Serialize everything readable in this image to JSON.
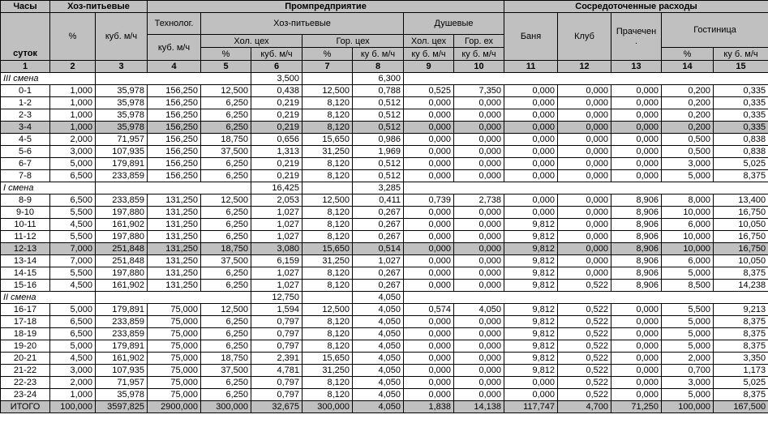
{
  "header": {
    "hours_top": "Часы",
    "hours_bottom": "суток",
    "household": "Хоз-питьевые",
    "pct": "%",
    "m3h": "куб. м/ч",
    "industry": "Промпредприятие",
    "concentrated": "Сосредоточенные расходы",
    "technolog": "Технолог.",
    "technolog_unit": "куб. м/ч",
    "industry_household": "Хоз-питьевые",
    "cold_shop": "Хол. цех",
    "hot_shop": "Гор. цех",
    "showers": "Душевые",
    "showers_cold": "Хол. цех",
    "showers_hot": "Гор. ех",
    "sub_pct": "%",
    "sub_m3h": "куб. м/ч",
    "sub_m3h_spaced": "ку б. м/ч",
    "banya": "Баня",
    "club": "Клуб",
    "laundry": "Прачечен",
    "laundry_dot": ".",
    "hotel": "Гостиница"
  },
  "column_numbers": [
    "1",
    "2",
    "3",
    "4",
    "5",
    "6",
    "7",
    "8",
    "9",
    "10",
    "11",
    "12",
    "13",
    "14",
    "15"
  ],
  "groups": [
    {
      "shift_label": "III смена",
      "shift_cold": "3,500",
      "shift_hot": "6,300",
      "rows": [
        {
          "band": false,
          "cells": [
            "0-1",
            "1,000",
            "35,978",
            "156,250",
            "12,500",
            "0,438",
            "12,500",
            "0,788",
            "0,525",
            "7,350",
            "0,000",
            "0,000",
            "0,000",
            "0,200",
            "0,335"
          ]
        },
        {
          "band": false,
          "cells": [
            "1-2",
            "1,000",
            "35,978",
            "156,250",
            "6,250",
            "0,219",
            "8,120",
            "0,512",
            "0,000",
            "0,000",
            "0,000",
            "0,000",
            "0,000",
            "0,200",
            "0,335"
          ]
        },
        {
          "band": false,
          "cells": [
            "2-3",
            "1,000",
            "35,978",
            "156,250",
            "6,250",
            "0,219",
            "8,120",
            "0,512",
            "0,000",
            "0,000",
            "0,000",
            "0,000",
            "0,000",
            "0,200",
            "0,335"
          ]
        },
        {
          "band": true,
          "cells": [
            "3-4",
            "1,000",
            "35,978",
            "156,250",
            "6,250",
            "0,219",
            "8,120",
            "0,512",
            "0,000",
            "0,000",
            "0,000",
            "0,000",
            "0,000",
            "0,200",
            "0,335"
          ]
        },
        {
          "band": false,
          "cells": [
            "4-5",
            "2,000",
            "71,957",
            "156,250",
            "18,750",
            "0,656",
            "15,650",
            "0,986",
            "0,000",
            "0,000",
            "0,000",
            "0,000",
            "0,000",
            "0,500",
            "0,838"
          ]
        },
        {
          "band": false,
          "cells": [
            "5-6",
            "3,000",
            "107,935",
            "156,250",
            "37,500",
            "1,313",
            "31,250",
            "1,969",
            "0,000",
            "0,000",
            "0,000",
            "0,000",
            "0,000",
            "0,500",
            "0,838"
          ]
        },
        {
          "band": false,
          "cells": [
            "6-7",
            "5,000",
            "179,891",
            "156,250",
            "6,250",
            "0,219",
            "8,120",
            "0,512",
            "0,000",
            "0,000",
            "0,000",
            "0,000",
            "0,000",
            "3,000",
            "5,025"
          ]
        },
        {
          "band": false,
          "cells": [
            "7-8",
            "6,500",
            "233,859",
            "156,250",
            "6,250",
            "0,219",
            "8,120",
            "0,512",
            "0,000",
            "0,000",
            "0,000",
            "0,000",
            "0,000",
            "5,000",
            "8,375"
          ]
        }
      ]
    },
    {
      "shift_label": "I смена",
      "shift_cold": "16,425",
      "shift_hot": "3,285",
      "rows": [
        {
          "band": false,
          "cells": [
            "8-9",
            "6,500",
            "233,859",
            "131,250",
            "12,500",
            "2,053",
            "12,500",
            "0,411",
            "0,739",
            "2,738",
            "0,000",
            "0,000",
            "8,906",
            "8,000",
            "13,400"
          ]
        },
        {
          "band": false,
          "cells": [
            "9-10",
            "5,500",
            "197,880",
            "131,250",
            "6,250",
            "1,027",
            "8,120",
            "0,267",
            "0,000",
            "0,000",
            "0,000",
            "0,000",
            "8,906",
            "10,000",
            "16,750"
          ]
        },
        {
          "band": false,
          "cells": [
            "10-11",
            "4,500",
            "161,902",
            "131,250",
            "6,250",
            "1,027",
            "8,120",
            "0,267",
            "0,000",
            "0,000",
            "9,812",
            "0,000",
            "8,906",
            "6,000",
            "10,050"
          ]
        },
        {
          "band": false,
          "cells": [
            "11-12",
            "5,500",
            "197,880",
            "131,250",
            "6,250",
            "1,027",
            "8,120",
            "0,267",
            "0,000",
            "0,000",
            "9,812",
            "0,000",
            "8,906",
            "10,000",
            "16,750"
          ]
        },
        {
          "band": true,
          "cells": [
            "12-13",
            "7,000",
            "251,848",
            "131,250",
            "18,750",
            "3,080",
            "15,650",
            "0,514",
            "0,000",
            "0,000",
            "9,812",
            "0,000",
            "8,906",
            "10,000",
            "16,750"
          ]
        },
        {
          "band": false,
          "cells": [
            "13-14",
            "7,000",
            "251,848",
            "131,250",
            "37,500",
            "6,159",
            "31,250",
            "1,027",
            "0,000",
            "0,000",
            "9,812",
            "0,000",
            "8,906",
            "6,000",
            "10,050"
          ]
        },
        {
          "band": false,
          "cells": [
            "14-15",
            "5,500",
            "197,880",
            "131,250",
            "6,250",
            "1,027",
            "8,120",
            "0,267",
            "0,000",
            "0,000",
            "9,812",
            "0,000",
            "8,906",
            "5,000",
            "8,375"
          ]
        },
        {
          "band": false,
          "cells": [
            "15-16",
            "4,500",
            "161,902",
            "131,250",
            "6,250",
            "1,027",
            "8,120",
            "0,267",
            "0,000",
            "0,000",
            "9,812",
            "0,522",
            "8,906",
            "8,500",
            "14,238"
          ]
        }
      ]
    },
    {
      "shift_label": "II смена",
      "shift_cold": "12,750",
      "shift_hot": "4,050",
      "rows": [
        {
          "band": false,
          "cells": [
            "16-17",
            "5,000",
            "179,891",
            "75,000",
            "12,500",
            "1,594",
            "12,500",
            "4,050",
            "0,574",
            "4,050",
            "9,812",
            "0,522",
            "0,000",
            "5,500",
            "9,213"
          ]
        },
        {
          "band": false,
          "cells": [
            "17-18",
            "6,500",
            "233,859",
            "75,000",
            "6,250",
            "0,797",
            "8,120",
            "4,050",
            "0,000",
            "0,000",
            "9,812",
            "0,522",
            "0,000",
            "5,000",
            "8,375"
          ]
        },
        {
          "band": false,
          "cells": [
            "18-19",
            "6,500",
            "233,859",
            "75,000",
            "6,250",
            "0,797",
            "8,120",
            "4,050",
            "0,000",
            "0,000",
            "9,812",
            "0,522",
            "0,000",
            "5,000",
            "8,375"
          ]
        },
        {
          "band": false,
          "cells": [
            "19-20",
            "5,000",
            "179,891",
            "75,000",
            "6,250",
            "0,797",
            "8,120",
            "4,050",
            "0,000",
            "0,000",
            "9,812",
            "0,522",
            "0,000",
            "5,000",
            "8,375"
          ]
        },
        {
          "band": false,
          "cells": [
            "20-21",
            "4,500",
            "161,902",
            "75,000",
            "18,750",
            "2,391",
            "15,650",
            "4,050",
            "0,000",
            "0,000",
            "9,812",
            "0,522",
            "0,000",
            "2,000",
            "3,350"
          ]
        },
        {
          "band": false,
          "cells": [
            "21-22",
            "3,000",
            "107,935",
            "75,000",
            "37,500",
            "4,781",
            "31,250",
            "4,050",
            "0,000",
            "0,000",
            "9,812",
            "0,522",
            "0,000",
            "0,700",
            "1,173"
          ]
        },
        {
          "band": false,
          "cells": [
            "22-23",
            "2,000",
            "71,957",
            "75,000",
            "6,250",
            "0,797",
            "8,120",
            "4,050",
            "0,000",
            "0,000",
            "0,000",
            "0,522",
            "0,000",
            "3,000",
            "5,025"
          ]
        },
        {
          "band": false,
          "cells": [
            "23-24",
            "1,000",
            "35,978",
            "75,000",
            "6,250",
            "0,797",
            "8,120",
            "4,050",
            "0,000",
            "0,000",
            "0,000",
            "0,522",
            "0,000",
            "5,000",
            "8,375"
          ]
        }
      ]
    }
  ],
  "total": [
    "ИТОГО",
    "100,000",
    "3597,825",
    "2900,000",
    "300,000",
    "32,675",
    "300,000",
    "4,050",
    "1,838",
    "14,138",
    "117,747",
    "4,700",
    "71,250",
    "100,000",
    "167,500"
  ]
}
